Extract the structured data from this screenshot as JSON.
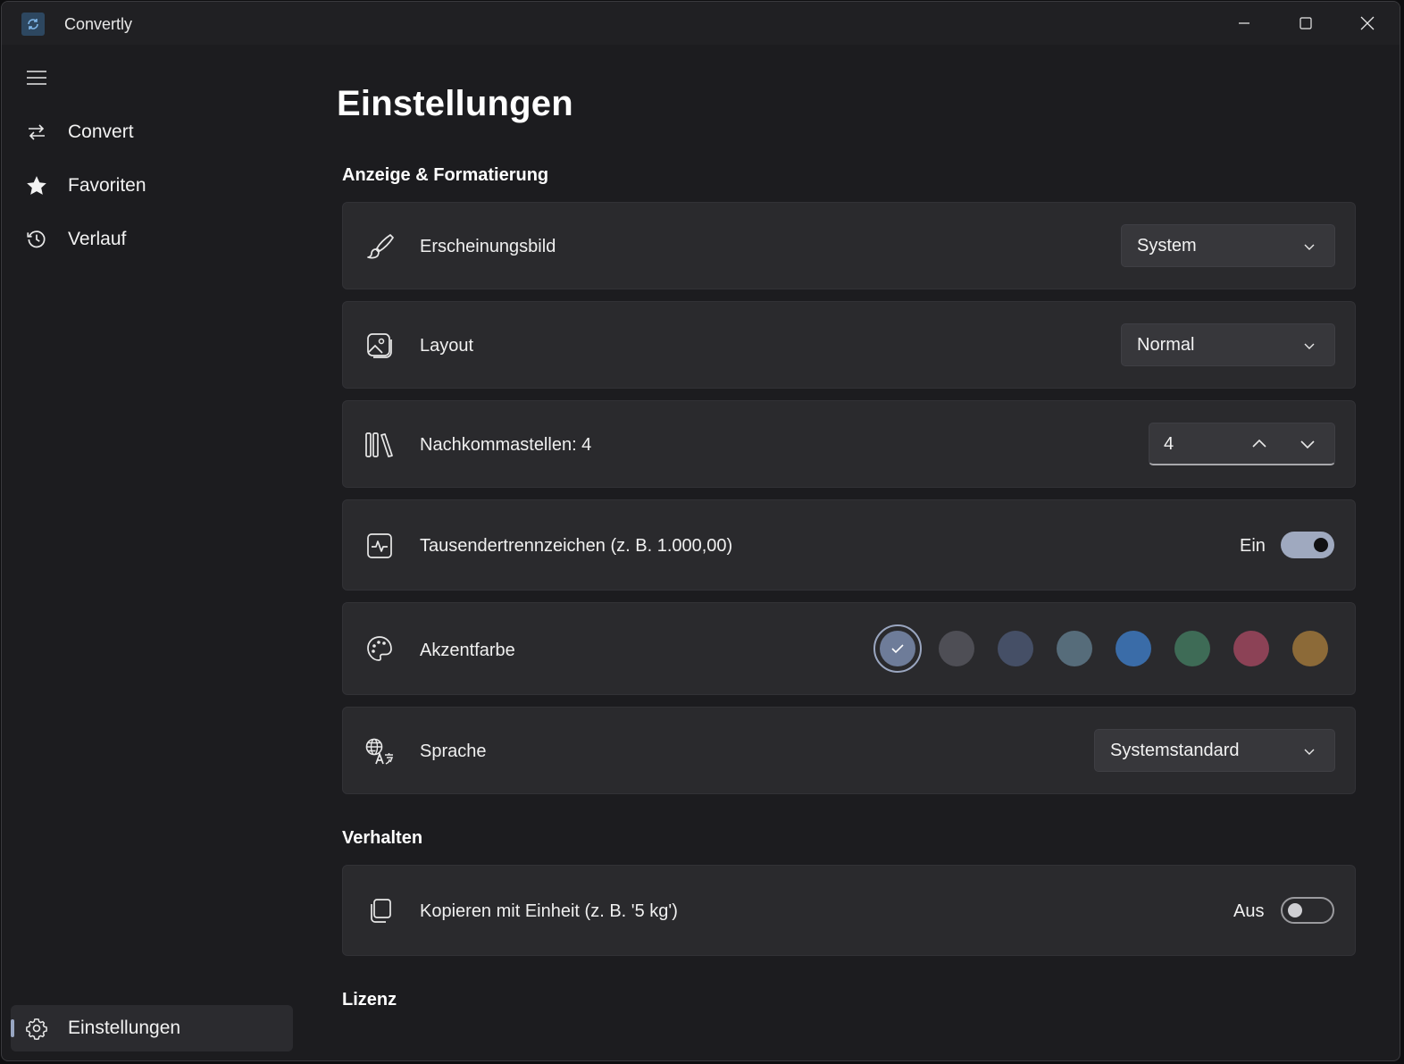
{
  "window": {
    "app_title": "Convertly",
    "controls": {
      "minimize": "minimize",
      "maximize": "maximize",
      "close": "close"
    }
  },
  "sidebar": {
    "items": [
      {
        "label": "Convert",
        "icon": "arrows-swap-icon"
      },
      {
        "label": "Favoriten",
        "icon": "star-icon"
      },
      {
        "label": "Verlauf",
        "icon": "history-icon"
      }
    ],
    "footer_item": {
      "label": "Einstellungen",
      "icon": "gear-icon",
      "selected": true
    }
  },
  "page": {
    "title": "Einstellungen",
    "sections": {
      "display": "Anzeige & Formatierung",
      "behavior": "Verhalten",
      "license": "Lizenz"
    },
    "settings": {
      "appearance": {
        "label": "Erscheinungsbild",
        "value": "System",
        "icon": "brush-icon"
      },
      "layout": {
        "label": "Layout",
        "value": "Normal",
        "icon": "image-icon"
      },
      "decimals": {
        "label": "Nachkommastellen: 4",
        "value": "4",
        "icon": "library-icon"
      },
      "thousands": {
        "label": "Tausendertrennzeichen (z. B. 1.000,00)",
        "state_label": "Ein",
        "on": true,
        "icon": "pulse-icon"
      },
      "accent": {
        "label": "Akzentfarbe",
        "icon": "palette-icon",
        "selected_index": 0,
        "colors": [
          "#6e7c99",
          "#4e4e55",
          "#454f66",
          "#566c7a",
          "#3a6ca8",
          "#3e6b56",
          "#8c4256",
          "#8c6a38"
        ]
      },
      "language": {
        "label": "Sprache",
        "value": "Systemstandard",
        "icon": "translate-icon"
      },
      "copy_unit": {
        "label": "Kopieren mit Einheit (z. B. '5 kg')",
        "state_label": "Aus",
        "on": false,
        "icon": "copy-icon"
      }
    }
  },
  "colors": {
    "accent": "#9fa9bf",
    "card": "#2a2a2d",
    "background": "#1c1c1f"
  }
}
